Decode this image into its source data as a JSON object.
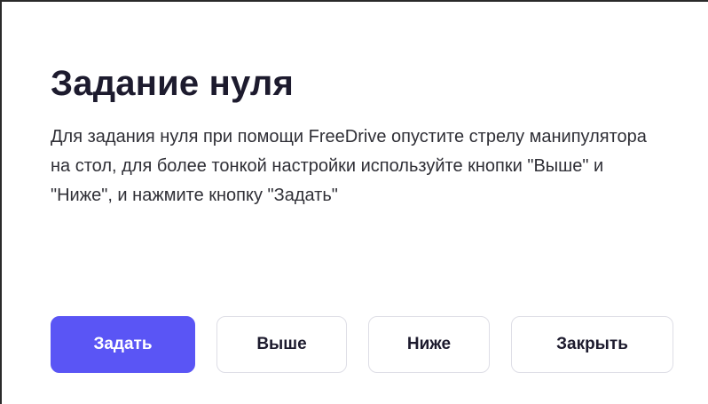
{
  "dialog": {
    "title": "Задание нуля",
    "message": "Для задания нуля при помощи FreeDrive опустите стрелу манипулятора на стол, для более тонкой настройки используйте кнопки \"Выше\" и \"Ниже\", и нажмите кнопку \"Задать\"",
    "buttons": {
      "set": "Задать",
      "up": "Выше",
      "down": "Ниже",
      "close": "Закрыть"
    }
  },
  "colors": {
    "primary": "#5a55f5",
    "title": "#1d1b2e",
    "text": "#2f2f36",
    "button_border": "#dedee6"
  }
}
